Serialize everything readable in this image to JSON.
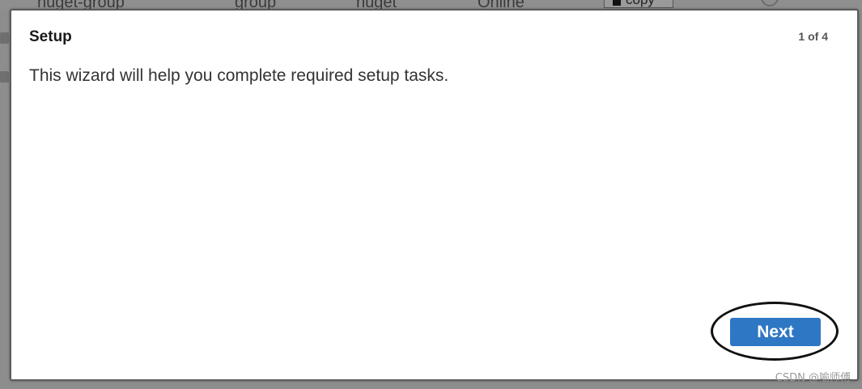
{
  "background_table": {
    "row": {
      "name": "nuget-group",
      "type": "group",
      "format": "nuget",
      "status": "Online",
      "copy_label": "copy"
    }
  },
  "modal": {
    "title": "Setup",
    "step": "1 of 4",
    "message": "This wizard will help you complete required setup tasks.",
    "next_label": "Next",
    "accent_color": "#2e77c4"
  },
  "watermark": "CSDN @喻师傅"
}
